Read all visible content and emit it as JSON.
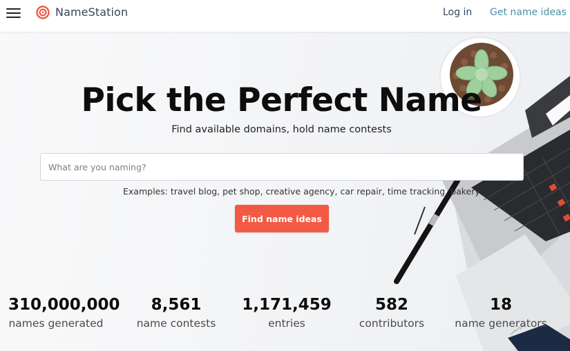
{
  "header": {
    "menu_icon": "hamburger-menu-icon",
    "logo_icon": "target-logo-icon",
    "brand": "NameStation",
    "login": "Log in",
    "get_ideas": "Get name ideas"
  },
  "hero": {
    "title": "Pick the Perfect Name",
    "subtitle": "Find available domains, hold name contests",
    "search_placeholder": "What are you naming?",
    "search_value": "",
    "examples": "Examples: travel blog, pet shop, creative agency, car repair, time tracking, bakery",
    "button": "Find name ideas"
  },
  "stats": [
    {
      "value": "310,000,000",
      "label": "names generated"
    },
    {
      "value": "8,561",
      "label": "name contests"
    },
    {
      "value": "1,171,459",
      "label": "entries"
    },
    {
      "value": "582",
      "label": "contributors"
    },
    {
      "value": "18",
      "label": "name generators"
    }
  ],
  "colors": {
    "accent": "#f25a45",
    "link": "#4a90a4",
    "nav_text": "#33475b"
  }
}
